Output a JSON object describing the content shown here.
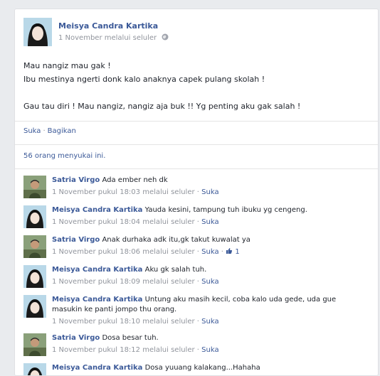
{
  "post": {
    "author": "Meisya Candra Kartika",
    "meta": "1 November melalui seluler",
    "lines": [
      "Mau nangiz mau gak !",
      "Ibu mestinya ngerti donk kalo anaknya capek pulang skolah !",
      "",
      "Gau tau diri ! Mau nangiz, nangiz aja buk !! Yg penting aku gak salah !"
    ],
    "actions": {
      "like": "Suka",
      "separator": "·",
      "share": "Bagikan"
    },
    "likes_text": "56 orang menyukai ini."
  },
  "comments": [
    {
      "name": "Satria Virgo",
      "text": "Ada ember neh dk",
      "time": "1 November pukul 18:03 melalui seluler",
      "like": "Suka",
      "avatar": "satria"
    },
    {
      "name": "Meisya Candra Kartika",
      "text": "Yauda kesini, tampung tuh ibuku yg cengeng.",
      "time": "1 November pukul 18:04 melalui seluler",
      "like": "Suka",
      "avatar": "meisya"
    },
    {
      "name": "Satria Virgo",
      "text": "Anak durhaka adk itu,gk takut kuwalat ya",
      "time": "1 November pukul 18:06 melalui seluler",
      "like": "Suka",
      "like_count": "1",
      "avatar": "satria"
    },
    {
      "name": "Meisya Candra Kartika",
      "text": "Aku gk salah tuh.",
      "time": "1 November pukul 18:09 melalui seluler",
      "like": "Suka",
      "avatar": "meisya"
    },
    {
      "name": "Meisya Candra Kartika",
      "text": "Untung aku masih kecil, coba kalo uda gede, uda gue masukin ke panti jompo thu orang.",
      "time": "1 November pukul 18:10 melalui seluler",
      "like": "Suka",
      "avatar": "meisya"
    },
    {
      "name": "Satria Virgo",
      "text": "Dosa besar tuh.",
      "time": "1 November pukul 18:12 melalui seluler",
      "like": "Suka",
      "avatar": "satria"
    },
    {
      "name": "Meisya Candra Kartika",
      "text": "Dosa yuuang kalakang...Hahaha",
      "time": "",
      "like": "",
      "avatar": "meisya"
    }
  ],
  "colors": {
    "link": "#3b5998",
    "meta": "#90949c",
    "background": "#e9ebee"
  }
}
